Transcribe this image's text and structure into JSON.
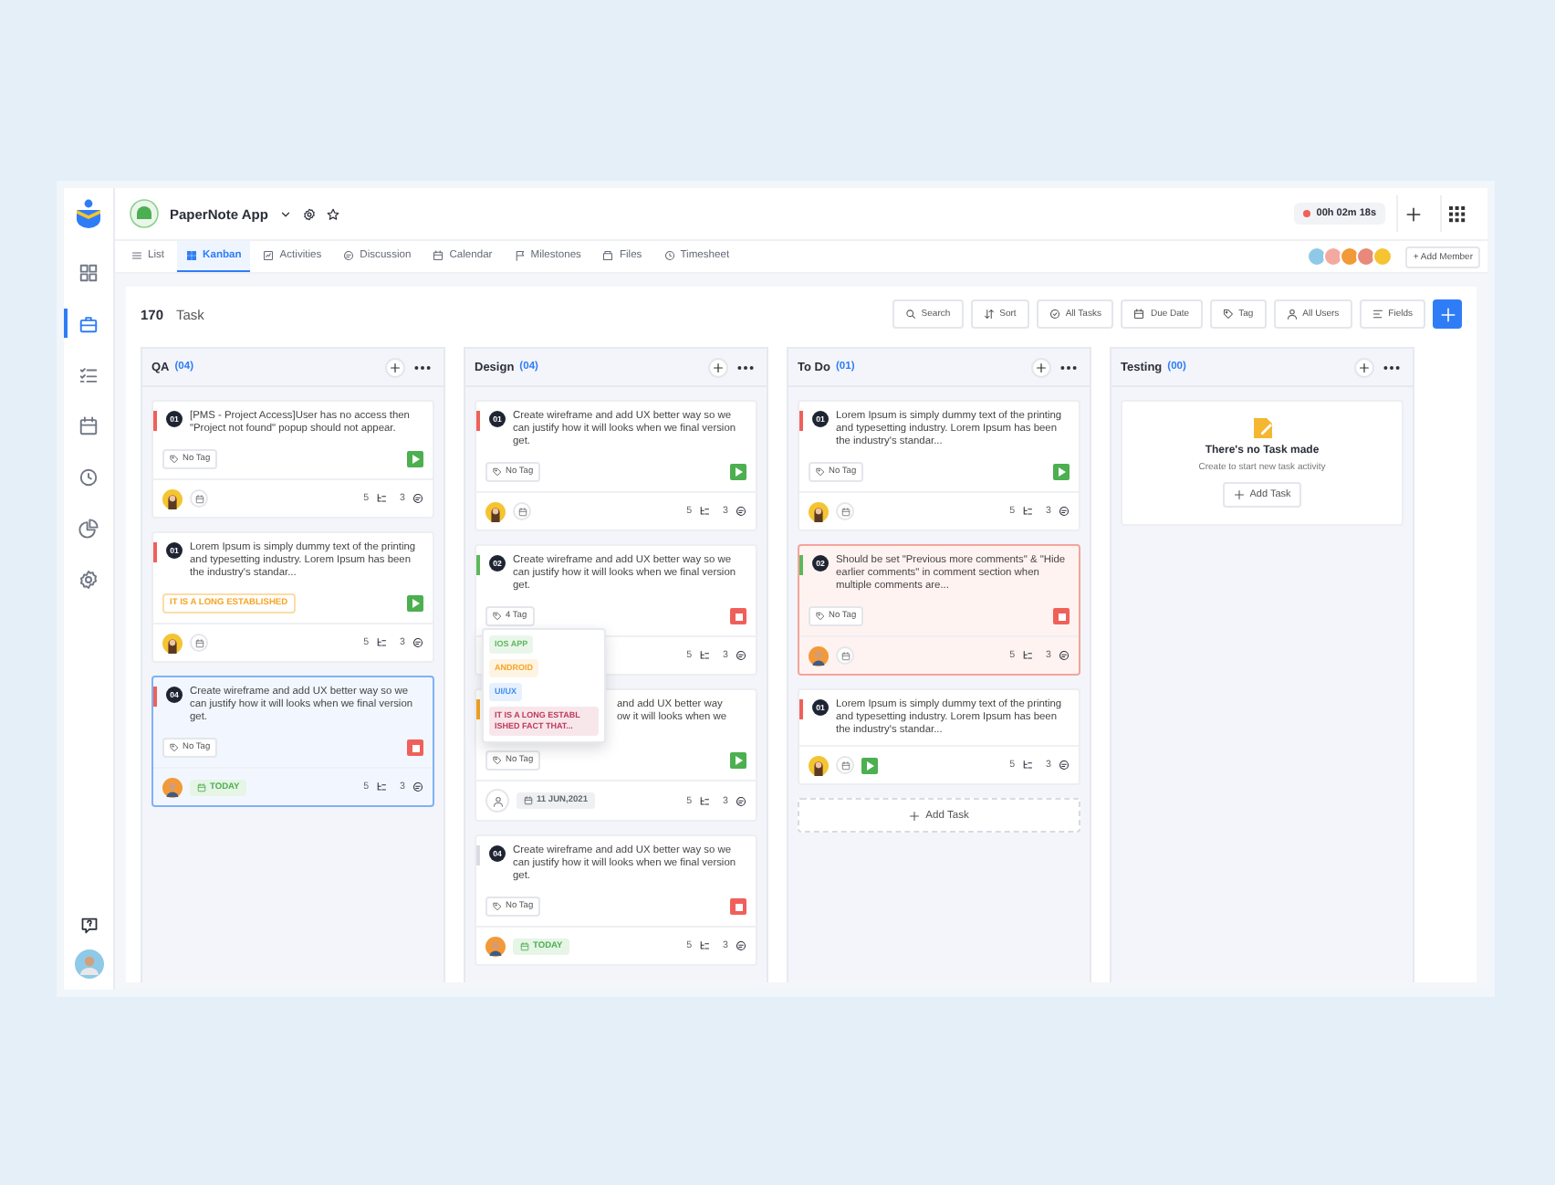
{
  "app": {
    "name": "PaperNote App",
    "timer": "00h 02m 18s"
  },
  "sidebar": {
    "items": [
      {
        "selected": false
      },
      {
        "selected": true
      },
      {
        "selected": false
      },
      {
        "selected": false
      },
      {
        "selected": false
      },
      {
        "selected": false
      },
      {
        "selected": false
      }
    ]
  },
  "tabs": [
    {
      "label": "List",
      "selected": false
    },
    {
      "label": "Kanban",
      "selected": true
    },
    {
      "label": "Activities",
      "selected": false
    },
    {
      "label": "Discussion",
      "selected": false
    },
    {
      "label": "Calendar",
      "selected": false
    },
    {
      "label": "Milestones",
      "selected": false
    },
    {
      "label": "Files",
      "selected": false
    },
    {
      "label": "Timesheet",
      "selected": false
    }
  ],
  "members": [
    {
      "color": "#8ec9e8"
    },
    {
      "color": "#f4a9a0"
    },
    {
      "color": "#f29a38"
    },
    {
      "color": "#e8897a"
    },
    {
      "color": "#f5c431"
    }
  ],
  "add_member": "+ Add Member",
  "task_count": {
    "number": "170",
    "label": "Task"
  },
  "toolbar": [
    {
      "label": "Search"
    },
    {
      "label": "Sort"
    },
    {
      "label": "All Tasks"
    },
    {
      "label": "Due Date"
    },
    {
      "label": "Tag"
    },
    {
      "label": "All Users"
    },
    {
      "label": "Fields"
    }
  ],
  "columns": [
    {
      "name": "QA",
      "count": "(04)",
      "cards": [
        {
          "kind": "standard",
          "number": "01",
          "text": "[PMS - Project Access]User has no access then \"Project not found\" popup should not appear.",
          "color": "#f0605a",
          "selected": false,
          "flagged": false,
          "running": false,
          "tag": {
            "kind": "plain",
            "text": "No Tag"
          },
          "assigned": true,
          "date": {
            "kind": "icon"
          },
          "subtasks": "5",
          "comments": "3"
        },
        {
          "kind": "standard",
          "number": "01",
          "text": "Lorem Ipsum is simply dummy text of the printing and typesetting industry. Lorem Ipsum has been the industry's standar...",
          "color": "#f0605a",
          "selected": false,
          "flagged": false,
          "running": false,
          "tag": {
            "kind": "label",
            "text": "IT IS A LONG ESTABLISHED"
          },
          "assigned": true,
          "date": {
            "kind": "icon"
          },
          "subtasks": "5",
          "comments": "3"
        },
        {
          "kind": "standard",
          "number": "04",
          "text": "Create wireframe and add UX better way so we can justify how it will looks when we final version get.",
          "color": "#f0605a",
          "selected": true,
          "flagged": false,
          "running": true,
          "tag": {
            "kind": "plain",
            "text": "No Tag"
          },
          "assigned": true,
          "date": {
            "kind": "today",
            "text": "TODAY"
          },
          "subtasks": "5",
          "comments": "3"
        }
      ]
    },
    {
      "name": "Design",
      "count": "(04)",
      "cards": [
        {
          "kind": "standard",
          "number": "01",
          "text": "Create wireframe and add UX better way so we can justify how it will looks when we final version get.",
          "color": "#f0605a",
          "selected": false,
          "flagged": false,
          "running": false,
          "tag": {
            "kind": "plain",
            "text": "No Tag"
          },
          "assigned": true,
          "date": {
            "kind": "icon"
          },
          "subtasks": "5",
          "comments": "3"
        },
        {
          "kind": "standard",
          "number": "02",
          "text": "Create wireframe and add UX better way so we can justify how it will looks when we final version get.",
          "color": "#5cb85c",
          "selected": false,
          "flagged": false,
          "running": true,
          "tag": {
            "kind": "plain",
            "text": "4 Tag"
          },
          "subtasks": "5",
          "comments": "3",
          "popup": [
            {
              "label": "IOS APP",
              "color": "#5cb85c"
            },
            {
              "label": "ANDROID",
              "color": "#f5a623"
            },
            {
              "label": "UI/UX",
              "color": "#3d8ef0"
            },
            {
              "label": "IT IS A LONG ESTABL ISHED FACT THAT...",
              "color": "#c0395a"
            }
          ]
        },
        {
          "kind": "standard",
          "text_lines": [
            "and add UX better way",
            "ow it will looks when we"
          ],
          "color": "#f5a623",
          "selected": false,
          "flagged": false,
          "running": false,
          "tag": {
            "kind": "plain",
            "text": "No Tag"
          },
          "assigned": false,
          "date": {
            "kind": "date",
            "text": "11 JUN,2021"
          },
          "subtasks": "5",
          "comments": "3"
        },
        {
          "kind": "standard",
          "number": "04",
          "text": "Create wireframe and add UX better way so we can justify how it will looks when we final version get.",
          "color": "#d8dce4",
          "selected": false,
          "flagged": false,
          "running": true,
          "tag": {
            "kind": "plain",
            "text": "No Tag"
          },
          "assigned": true,
          "date": {
            "kind": "today",
            "text": "TODAY"
          },
          "subtasks": "5",
          "comments": "3"
        }
      ]
    },
    {
      "name": "To Do",
      "count": "(01)",
      "add_task": "Add Task",
      "cards": [
        {
          "kind": "standard",
          "number": "01",
          "text": "Lorem Ipsum is simply dummy text of the printing and typesetting industry. Lorem Ipsum has been the industry's standar...",
          "color": "#f0605a",
          "selected": false,
          "flagged": false,
          "running": false,
          "tag": {
            "kind": "plain",
            "text": "No Tag"
          },
          "assigned": true,
          "date": {
            "kind": "icon"
          },
          "subtasks": "5",
          "comments": "3"
        },
        {
          "kind": "standard",
          "number": "02",
          "text": "Should be set \"Previous more comments\" & \"Hide earlier comments\" in comment section when multiple comments are...",
          "color": "#5cb85c",
          "selected": false,
          "flagged": true,
          "running": true,
          "tag": {
            "kind": "plain",
            "text": "No Tag"
          },
          "assigned": true,
          "date": {
            "kind": "icon"
          },
          "subtasks": "5",
          "comments": "3"
        },
        {
          "kind": "compact",
          "number": "01",
          "text": "Lorem Ipsum is simply dummy text of the printing and typesetting industry. Lorem Ipsum has been the industry's standar...",
          "color": "#f0605a",
          "selected": false,
          "flagged": false,
          "running": false,
          "assigned": true,
          "date": {
            "kind": "icon"
          },
          "subtasks": "5",
          "comments": "3"
        }
      ]
    },
    {
      "name": "Testing",
      "count": "(00)",
      "empty": {
        "title": "There's no Task made",
        "subtitle": "Create to start new task activity",
        "button": "Add Task"
      }
    }
  ]
}
